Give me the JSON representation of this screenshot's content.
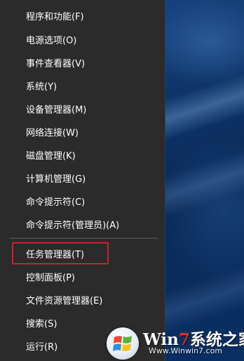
{
  "menu": {
    "items": [
      {
        "name": "programs-and-features",
        "label": "程序和功能(F)"
      },
      {
        "name": "power-options",
        "label": "电源选项(O)"
      },
      {
        "name": "event-viewer",
        "label": "事件查看器(V)"
      },
      {
        "name": "system",
        "label": "系统(Y)"
      },
      {
        "name": "device-manager",
        "label": "设备管理器(M)"
      },
      {
        "name": "network-connections",
        "label": "网络连接(W)"
      },
      {
        "name": "disk-management",
        "label": "磁盘管理(K)"
      },
      {
        "name": "computer-management",
        "label": "计算机管理(G)"
      },
      {
        "name": "command-prompt",
        "label": "命令提示符(C)"
      },
      {
        "name": "command-prompt-admin",
        "label": "命令提示符(管理员)(A)"
      },
      {
        "name": "task-manager",
        "label": "任务管理器(T)",
        "highlighted": true
      },
      {
        "name": "control-panel",
        "label": "控制面板(P)"
      },
      {
        "name": "file-explorer",
        "label": "文件资源管理器(E)"
      },
      {
        "name": "search",
        "label": "搜索(S)"
      },
      {
        "name": "run",
        "label": "运行(R)"
      }
    ]
  },
  "watermark": {
    "brand_prefix": "Win",
    "brand_seven": "7",
    "brand_suffix": "系统之家",
    "url": "Www.Winwin7.com",
    "icon": "windows-logo-icon"
  },
  "colors": {
    "menu_background": "#2b2b2b",
    "menu_text": "#ffffff",
    "highlight_border": "#c7232a",
    "desktop_blue": "#0e3469"
  }
}
